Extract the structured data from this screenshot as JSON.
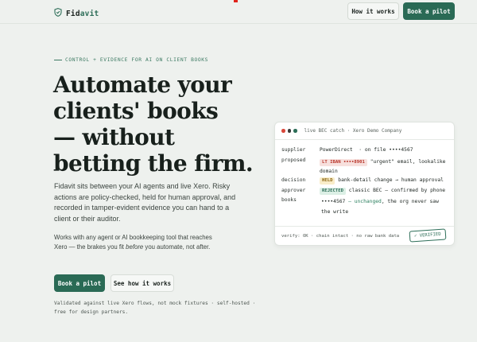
{
  "header": {
    "brand_accent": "Fid",
    "brand_rest": "avit",
    "nav_how": "How it works",
    "nav_book": "Book a pilot"
  },
  "hero": {
    "eyebrow": "CONTROL + EVIDENCE FOR AI ON CLIENT BOOKS",
    "title_lines": [
      "Automate your",
      "clients' books",
      "— without",
      "betting the firm."
    ],
    "lede": "Fidavit sits between your AI agents and live Xero. Risky actions are policy-checked, held for human approval, and recorded in tamper-evident evidence you can hand to a client or their auditor.",
    "sub_before": "Works with any agent or AI bookkeeping tool that reaches Xero — the brakes you fit ",
    "sub_em": "before",
    "sub_after": " you automate, not after.",
    "cta_book": "Book a pilot",
    "cta_how": "See how it works",
    "footnote": "Validated against live Xero flows, not mock fixtures · self-hosted · free for design partners."
  },
  "panel": {
    "title": "live BEC catch · Xero Demo Company",
    "rows": {
      "supplier_key": "supplier",
      "supplier_value_1": "PowerDirect",
      "supplier_value_2": "·  on file ••••4567",
      "proposed_key": "proposed",
      "proposed_tag": "LT IBAN ••••8901",
      "proposed_value": "\"urgent\" email, lookalike domain",
      "decision_key": "decision",
      "decision_tag": "HELD",
      "decision_value": "bank-detail change → human approval",
      "approver_key": "approver",
      "approver_tag": "REJECTED",
      "approver_value": "classic BEC — confirmed by phone",
      "books_key": "books",
      "books_value_1": "••••4567",
      "books_value_2": " — unchanged",
      "books_value_3": ", the org never saw the write"
    },
    "verify": "verify: OK · chain intact · no raw bank data",
    "verified_badge": "✓ VERIFIED"
  },
  "colors": {
    "accent": "#2a6a55",
    "background": "#eef1ee",
    "dot_red": "#d9483b",
    "dot_yellow": "#3a3a3a",
    "dot_green": "#2d6e58"
  },
  "icons": {
    "brand": "shield-check-icon"
  }
}
